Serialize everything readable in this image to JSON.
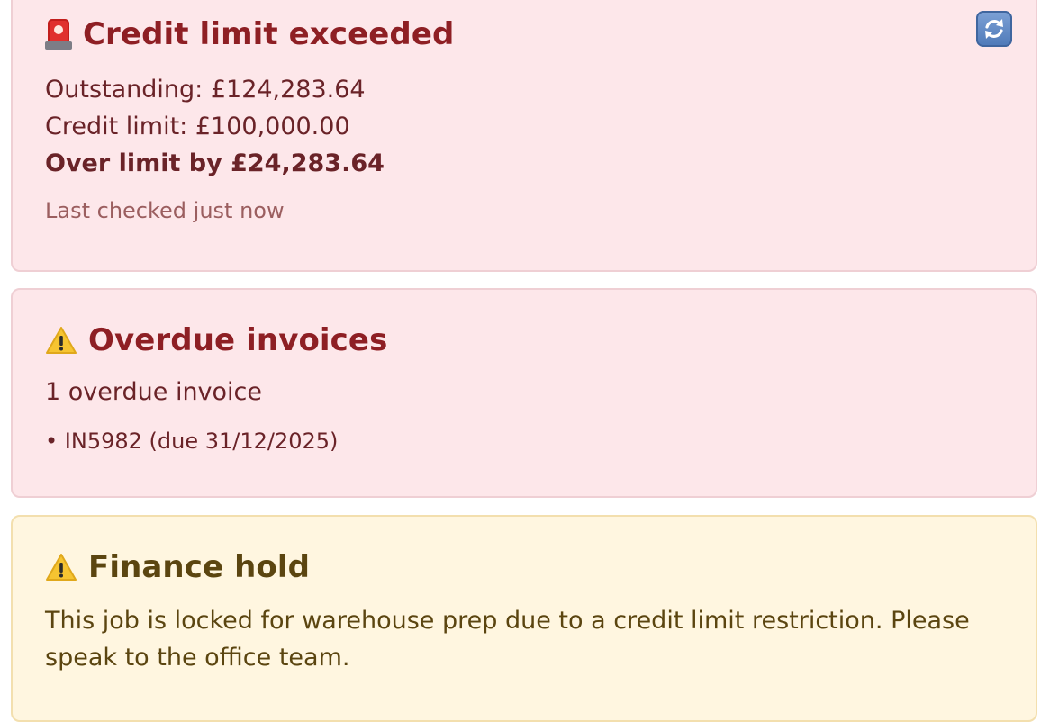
{
  "credit_alert": {
    "icon": "siren-icon",
    "title": "Credit limit exceeded",
    "outstanding": "Outstanding: £124,283.64",
    "credit_limit": "Credit limit: £100,000.00",
    "over_limit": "Over limit by £24,283.64",
    "last_checked": "Last checked just now",
    "refresh_icon": "refresh-icon"
  },
  "overdue_alert": {
    "icon": "warning-icon",
    "title": "Overdue invoices",
    "summary": "1 overdue invoice",
    "invoices": [
      {
        "text": "• IN5982 (due 31/12/2025)"
      }
    ]
  },
  "finance_hold": {
    "icon": "warning-icon",
    "title": "Finance hold",
    "message_line1": "This job is locked for warehouse prep due to a credit limit restriction. Please",
    "message_line2": "speak to the office team."
  },
  "colors": {
    "danger_bg": "#fde7ea",
    "danger_text": "#8e1f24",
    "warning_bg": "#fff6e0",
    "warning_text": "#5b4510",
    "refresh_blue": "#4e79b8"
  }
}
